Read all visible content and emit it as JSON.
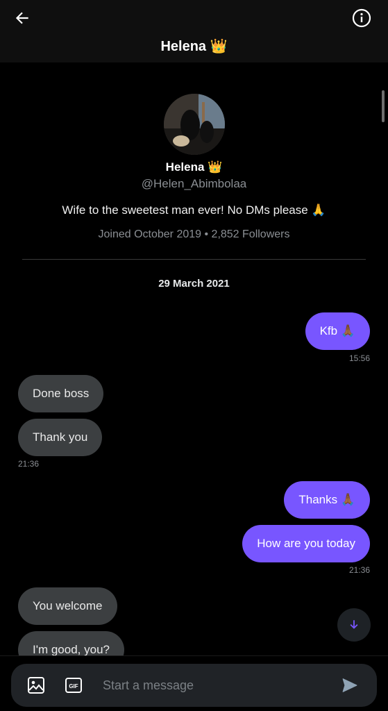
{
  "header": {
    "title": "Helena 👑"
  },
  "profile": {
    "name": "Helena 👑",
    "handle": "@Helen_Abimbolaa",
    "bio": "Wife to the sweetest man ever! No DMs please 🙏",
    "meta": "Joined October 2019 • 2,852 Followers"
  },
  "conversation": {
    "date": "29 March 2021",
    "messages": [
      {
        "text": "Kfb 🙏🏾",
        "direction": "out"
      },
      {
        "text": "Done boss",
        "direction": "in"
      },
      {
        "text": "Thank you",
        "direction": "in"
      },
      {
        "text": "Thanks 🙏🏾",
        "direction": "out"
      },
      {
        "text": "How are you today",
        "direction": "out"
      },
      {
        "text": "You welcome",
        "direction": "in"
      },
      {
        "text": "I'm good, you?",
        "direction": "in"
      }
    ],
    "timestamps": [
      "15:56",
      "21:36",
      "21:36"
    ]
  },
  "composer": {
    "placeholder": "Start a message"
  },
  "colors": {
    "accent": "#7856ff",
    "incoming_bubble": "#3c3f41",
    "background": "#000000"
  },
  "icons": [
    "back-arrow-icon",
    "info-icon",
    "image-icon",
    "gif-icon",
    "send-icon",
    "arrow-down-icon"
  ]
}
